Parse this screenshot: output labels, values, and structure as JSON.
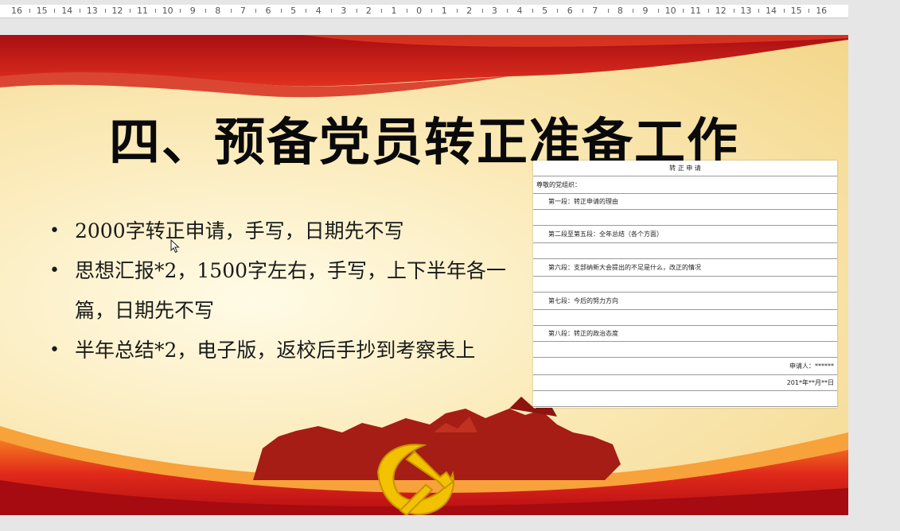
{
  "ruler": {
    "labels": [
      "16",
      "15",
      "14",
      "13",
      "12",
      "11",
      "10",
      "9",
      "8",
      "7",
      "6",
      "5",
      "4",
      "3",
      "2",
      "1",
      "0",
      "1",
      "2",
      "3",
      "4",
      "5",
      "6",
      "7",
      "8",
      "9",
      "10",
      "11",
      "12",
      "13",
      "14",
      "15",
      "16"
    ]
  },
  "slide": {
    "title": "四、预备党员转正准备工作",
    "bullets": [
      "2000字转正申请，手写，日期先不写",
      "思想汇报*2，1500字左右，手写，上下半年各一篇，日期先不写",
      "半年总结*2，电子版，返校后手抄到考察表上"
    ],
    "form": {
      "heading": "转 正 申 请",
      "salutation": "尊敬的党组织：",
      "paragraphs": [
        "第一段：转正申请的理由",
        "第二段至第五段：全年总结（各个方面）",
        "第六段：支部纳新大会提出的不足是什么，改正的情况",
        "第七段：今后的努力方向",
        "第八段：转正的政治态度"
      ],
      "applicant": "申请人：******",
      "date": "201*年**月**日"
    }
  },
  "colors": {
    "banner_red": "#c4161c",
    "emblem_gold": "#f2c200",
    "background_gold": "#f3d68a"
  }
}
